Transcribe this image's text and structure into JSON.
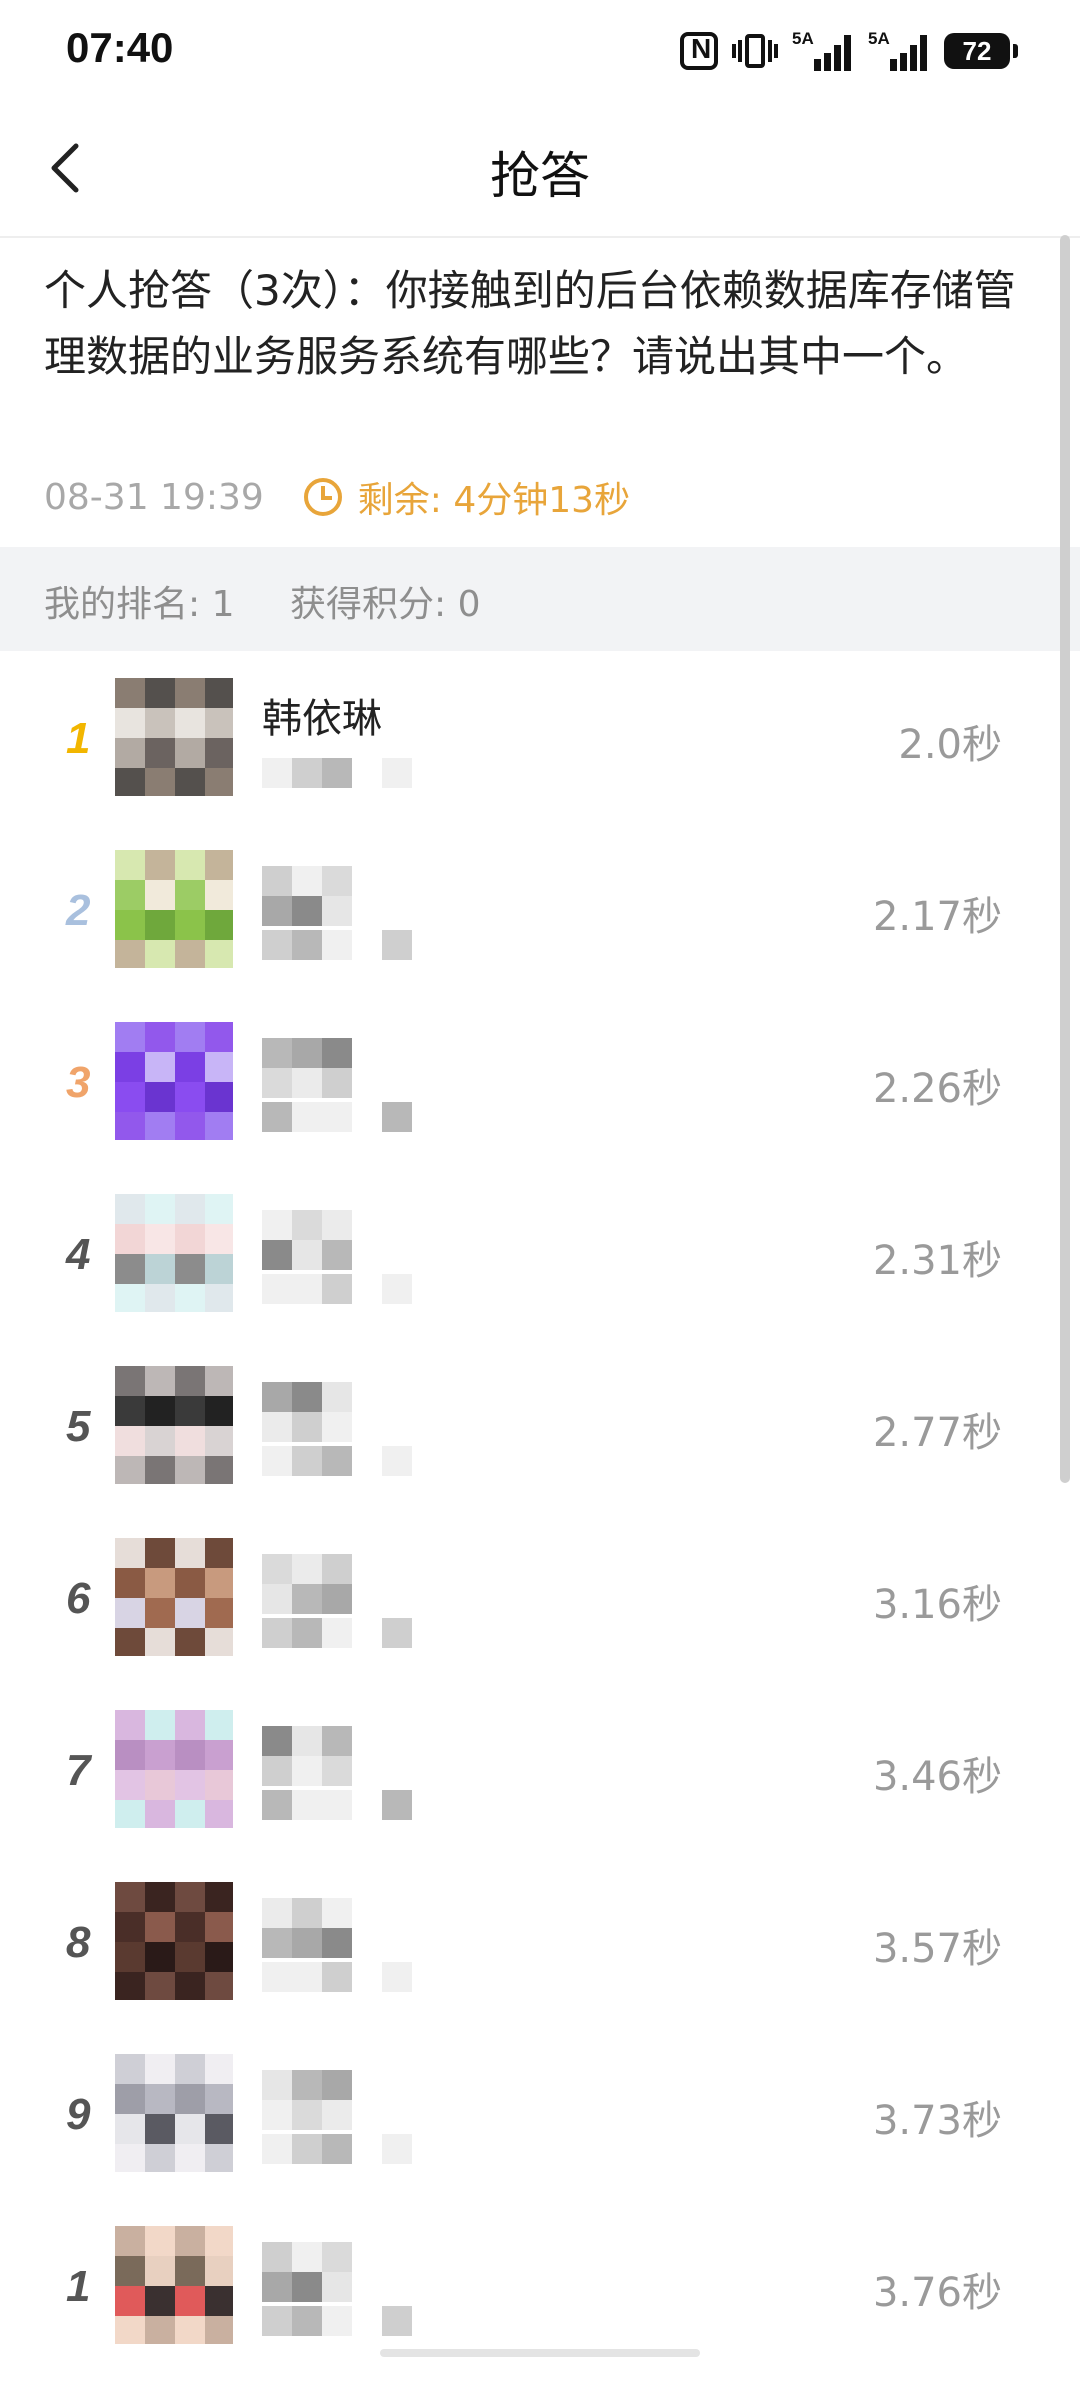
{
  "status_bar": {
    "time": "07:40",
    "sim1_label": "5A",
    "sim2_label": "5A",
    "battery": "72",
    "icons": [
      "nfc-icon",
      "vibrate-icon",
      "signal-icon",
      "signal-icon",
      "battery-icon"
    ]
  },
  "header": {
    "title": "抢答",
    "back_icon": "chevron-left-icon"
  },
  "question": {
    "text": "个人抢答（3次）：你接触到的后台依赖数据库存储管理数据的业务服务系统有哪些？请说出其中一个。",
    "date": "08-31 19:39",
    "remaining_label": "剩余: 4分钟13秒",
    "remaining_icon": "clock-icon"
  },
  "my_stats": {
    "rank_label": "我的排名: 1",
    "points_label": "获得积分: 0"
  },
  "colors": {
    "accent_orange": "#e8a53a",
    "rank1": "#f2b600",
    "rank2": "#a9c0de",
    "rank3": "#f0a46a",
    "rank_other": "#555555"
  },
  "ranking": [
    {
      "rank": "1",
      "name": "韩依琳",
      "time": "2.0秒"
    },
    {
      "rank": "2",
      "name": "",
      "time": "2.17秒"
    },
    {
      "rank": "3",
      "name": "",
      "time": "2.26秒"
    },
    {
      "rank": "4",
      "name": "",
      "time": "2.31秒"
    },
    {
      "rank": "5",
      "name": "",
      "time": "2.77秒"
    },
    {
      "rank": "6",
      "name": "",
      "time": "3.16秒"
    },
    {
      "rank": "7",
      "name": "",
      "time": "3.46秒"
    },
    {
      "rank": "8",
      "name": "",
      "time": "3.57秒"
    },
    {
      "rank": "9",
      "name": "",
      "time": "3.73秒"
    },
    {
      "rank": "1",
      "name": "",
      "time": "3.76秒"
    }
  ]
}
